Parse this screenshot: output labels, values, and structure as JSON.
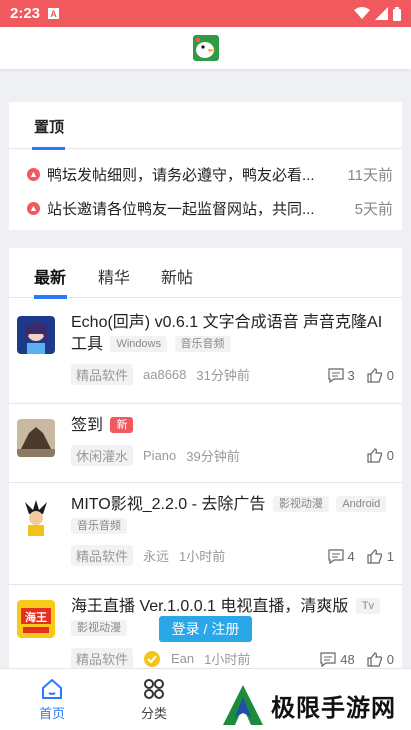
{
  "statusbar": {
    "time": "2:23",
    "notif_icon": "A"
  },
  "topbar": {
    "logo": "duck-logo-icon"
  },
  "pinned": {
    "heading": "置顶",
    "items": [
      {
        "title": "鸭坛发帖细则，请务必遵守，鸭友必看...",
        "date": "11天前"
      },
      {
        "title": "站长邀请各位鸭友一起监督网站，共同...",
        "date": "5天前"
      }
    ]
  },
  "tabs": {
    "items": [
      "最新",
      "精华",
      "新帖"
    ],
    "active": 0
  },
  "posts": [
    {
      "title": "Echo(回声) v0.6.1 文字合成语音 声音克隆AI工具",
      "tags": [
        "Windows",
        "音乐音频"
      ],
      "category": "精品软件",
      "author": "aa8668",
      "time": "31分钟前",
      "comments": "3",
      "likes": "0"
    },
    {
      "title": "签到",
      "badge": "新",
      "category": "休闲灌水",
      "author": "Piano",
      "time": "39分钟前",
      "likes": "0"
    },
    {
      "title": "MITO影视_2.2.0 - 去除广告",
      "tags": [
        "影视动漫",
        "Android",
        "音乐音频"
      ],
      "category": "精品软件",
      "author": "永远",
      "time": "1小时前",
      "comments": "4",
      "likes": "1"
    },
    {
      "title": "海王直播 Ver.1.0.0.1 电视直播，清爽版",
      "tags": [
        "Tv",
        "影视动漫"
      ],
      "category": "精品软件",
      "author": "Ean",
      "time": "1小时前",
      "comments": "48",
      "likes": "0"
    }
  ],
  "login_button": "登录 / 注册",
  "bottomnav": {
    "home": "首页",
    "category": "分类"
  },
  "watermark": "极限手游网",
  "colors": {
    "accent": "#2979ff",
    "statusbar": "#f05a5f",
    "login": "#2aa7e8"
  }
}
